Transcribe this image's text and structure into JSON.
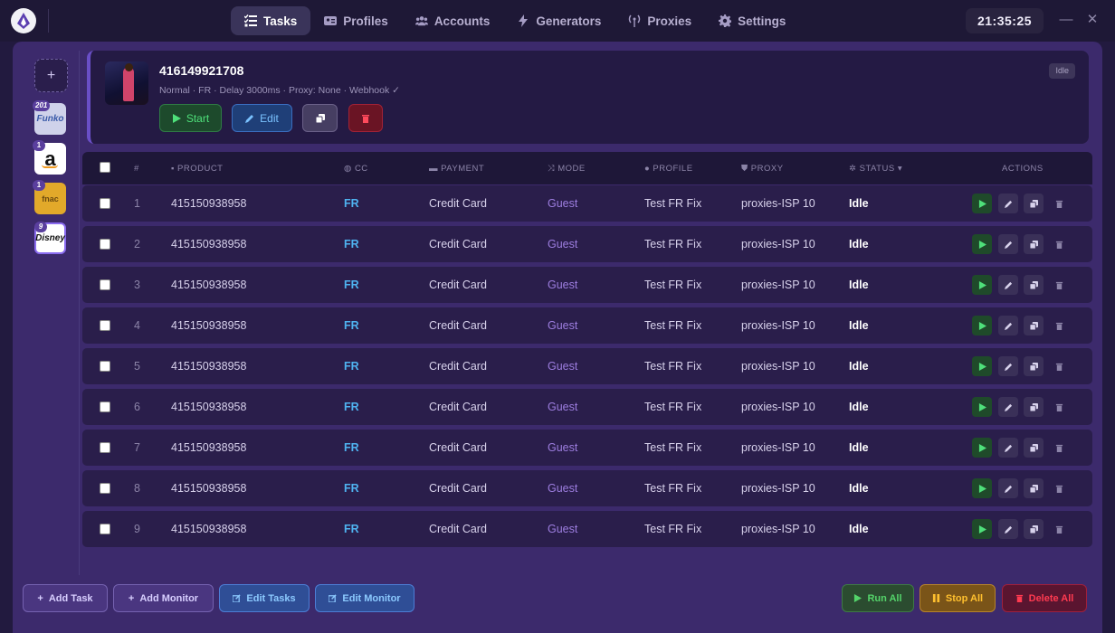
{
  "nav": {
    "items": [
      {
        "label": "Tasks",
        "icon": "tasks-icon"
      },
      {
        "label": "Profiles",
        "icon": "profile-card-icon"
      },
      {
        "label": "Accounts",
        "icon": "users-icon"
      },
      {
        "label": "Generators",
        "icon": "bolt-icon"
      },
      {
        "label": "Proxies",
        "icon": "antenna-icon"
      },
      {
        "label": "Settings",
        "icon": "gear-icon"
      }
    ],
    "active": "Tasks"
  },
  "clock": "21:35:25",
  "sidebar": {
    "add_label": "+",
    "stores": [
      {
        "name": "Funko",
        "badge": "201"
      },
      {
        "name": "Amazon",
        "badge": "1"
      },
      {
        "name": "Fnac",
        "badge": "1"
      },
      {
        "name": "Disney",
        "badge": "9"
      }
    ]
  },
  "group": {
    "title": "416149921708",
    "subtitle": "Normal · FR · Delay 3000ms · Proxy: None · Webhook ✓",
    "status": "Idle",
    "start_label": "Start",
    "edit_label": "Edit"
  },
  "table": {
    "headers": {
      "num": "#",
      "product": "PRODUCT",
      "cc": "CC",
      "payment": "PAYMENT",
      "mode": "MODE",
      "profile": "PROFILE",
      "proxy": "PROXY",
      "status": "STATUS",
      "actions": "ACTIONS"
    },
    "rows": [
      {
        "num": "1",
        "product": "415150938958",
        "cc": "FR",
        "payment": "Credit Card",
        "mode": "Guest",
        "profile": "Test FR Fix",
        "proxy": "proxies-ISP 10",
        "status": "Idle"
      },
      {
        "num": "2",
        "product": "415150938958",
        "cc": "FR",
        "payment": "Credit Card",
        "mode": "Guest",
        "profile": "Test FR Fix",
        "proxy": "proxies-ISP 10",
        "status": "Idle"
      },
      {
        "num": "3",
        "product": "415150938958",
        "cc": "FR",
        "payment": "Credit Card",
        "mode": "Guest",
        "profile": "Test FR Fix",
        "proxy": "proxies-ISP 10",
        "status": "Idle"
      },
      {
        "num": "4",
        "product": "415150938958",
        "cc": "FR",
        "payment": "Credit Card",
        "mode": "Guest",
        "profile": "Test FR Fix",
        "proxy": "proxies-ISP 10",
        "status": "Idle"
      },
      {
        "num": "5",
        "product": "415150938958",
        "cc": "FR",
        "payment": "Credit Card",
        "mode": "Guest",
        "profile": "Test FR Fix",
        "proxy": "proxies-ISP 10",
        "status": "Idle"
      },
      {
        "num": "6",
        "product": "415150938958",
        "cc": "FR",
        "payment": "Credit Card",
        "mode": "Guest",
        "profile": "Test FR Fix",
        "proxy": "proxies-ISP 10",
        "status": "Idle"
      },
      {
        "num": "7",
        "product": "415150938958",
        "cc": "FR",
        "payment": "Credit Card",
        "mode": "Guest",
        "profile": "Test FR Fix",
        "proxy": "proxies-ISP 10",
        "status": "Idle"
      },
      {
        "num": "8",
        "product": "415150938958",
        "cc": "FR",
        "payment": "Credit Card",
        "mode": "Guest",
        "profile": "Test FR Fix",
        "proxy": "proxies-ISP 10",
        "status": "Idle"
      },
      {
        "num": "9",
        "product": "415150938958",
        "cc": "FR",
        "payment": "Credit Card",
        "mode": "Guest",
        "profile": "Test FR Fix",
        "proxy": "proxies-ISP 10",
        "status": "Idle"
      }
    ]
  },
  "footer": {
    "add_task": "Add Task",
    "add_monitor": "Add Monitor",
    "edit_tasks": "Edit Tasks",
    "edit_monitor": "Edit Monitor",
    "run_all": "Run All",
    "stop_all": "Stop All",
    "delete_all": "Delete All"
  },
  "colors": {
    "accent": "#6a4fc7",
    "cc_text": "#4fb3f0",
    "mode_text": "#9d7ee0",
    "start_green": "#3cd16b",
    "edit_blue": "#5ab4f5",
    "stop_orange": "#f0a020",
    "delete_red": "#e8283e"
  }
}
